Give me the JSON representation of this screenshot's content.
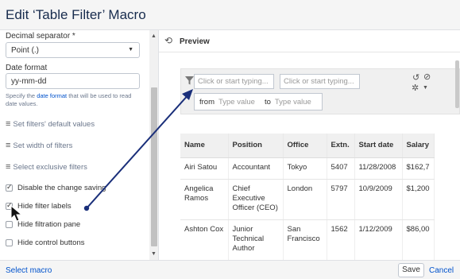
{
  "dialog": {
    "title": "Edit ‘Table Filter’ Macro"
  },
  "left": {
    "decimal_separator": {
      "label": "Decimal separator *",
      "value": "Point (.)"
    },
    "date_format": {
      "label": "Date format",
      "value": "yy-mm-dd",
      "help_prefix": "Specify the ",
      "help_link": "date format",
      "help_suffix": " that will be used to read date values."
    },
    "links": [
      "Set filters' default values",
      "Set width of filters",
      "Select exclusive filters"
    ],
    "checkboxes": [
      {
        "label": "Disable the change saving",
        "checked": true
      },
      {
        "label": "Hide filter labels",
        "checked": true
      },
      {
        "label": "Hide filtration pane",
        "checked": false
      },
      {
        "label": "Hide control buttons",
        "checked": false
      }
    ]
  },
  "preview": {
    "label": "Preview",
    "filter_placeholder_1": "Click or start typing...",
    "filter_placeholder_2": "Click or start typing...",
    "range_from": "from",
    "range_to": "to",
    "range_placeholder": "Type value",
    "table": {
      "headers": [
        "Name",
        "Position",
        "Office",
        "Extn.",
        "Start date",
        "Salary"
      ],
      "rows": [
        [
          "Airi Satou",
          "Accountant",
          "Tokyo",
          "5407",
          "11/28/2008",
          "$162,7"
        ],
        [
          "Angelica Ramos",
          "Chief Executive Officer (CEO)",
          "London",
          "5797",
          "10/9/2009",
          "$1,200"
        ],
        [
          "Ashton Cox",
          "Junior Technical Author",
          "San Francisco",
          "1562",
          "1/12/2009",
          "$86,00"
        ]
      ]
    }
  },
  "footer": {
    "select_macro": "Select macro",
    "save": "Save",
    "cancel": "Cancel"
  },
  "colors": {
    "link": "#0052cc",
    "arrow": "#1a2f7a"
  }
}
